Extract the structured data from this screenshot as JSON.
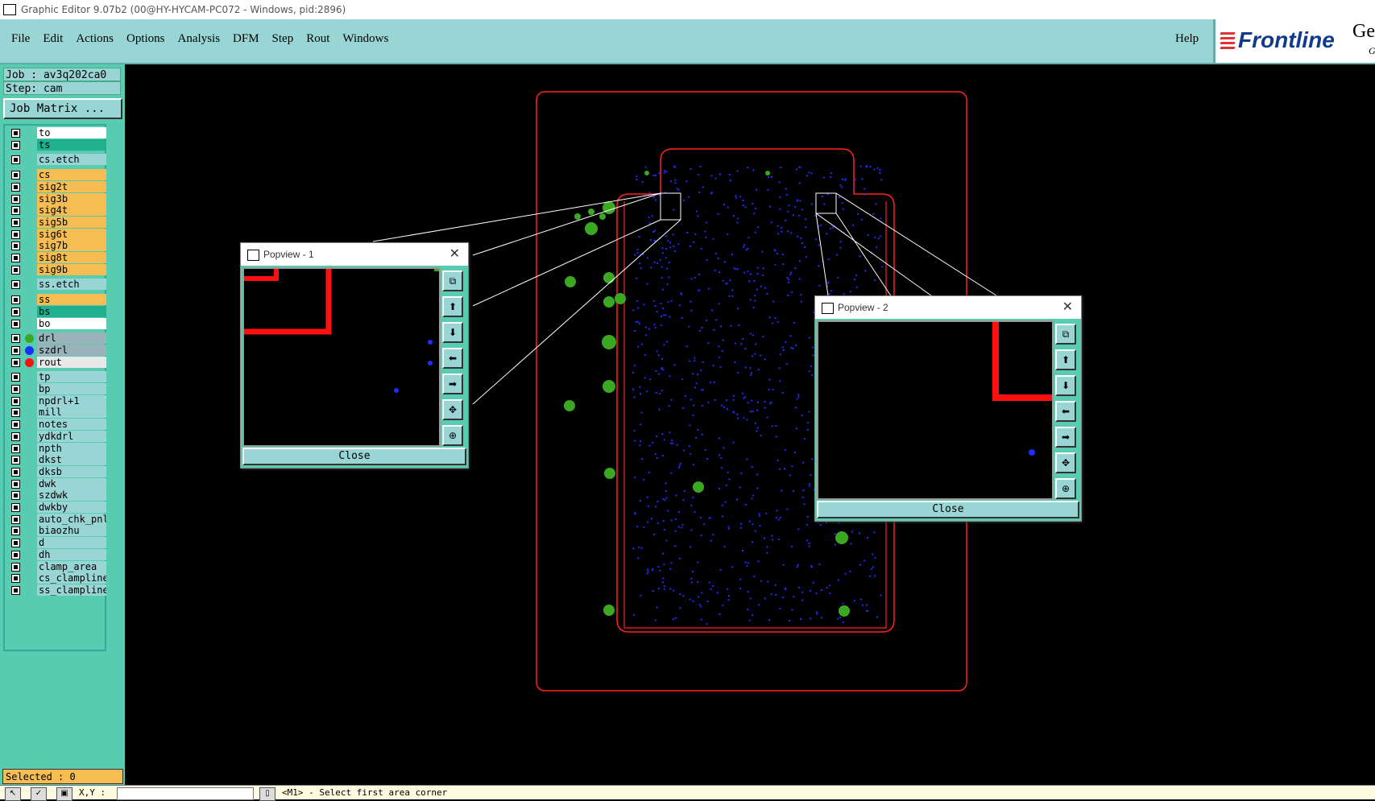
{
  "window": {
    "title": "Graphic Editor 9.07b2 (00@HY-HYCAM-PC072 - Windows, pid:2896)"
  },
  "menu": {
    "items": [
      "File",
      "Edit",
      "Actions",
      "Options",
      "Analysis",
      "DFM",
      "Step",
      "Rout",
      "Windows"
    ],
    "help": "Help"
  },
  "brand": {
    "logo_text": "Frontline",
    "extra": "Ge",
    "extra2": "G"
  },
  "job": {
    "job_label": "Job : av3q202ca0",
    "step_label": "Step: cam",
    "matrix_button": "Job Matrix ..."
  },
  "layers": [
    {
      "name": "to",
      "color": "#ffffff",
      "dot": ""
    },
    {
      "name": "ts",
      "color": "#1fb08e",
      "dot": ""
    },
    {
      "name": "cs.etch",
      "color": "#99d5d5",
      "dot": ""
    },
    {
      "name": "cs",
      "color": "#f5bd52",
      "dot": ""
    },
    {
      "name": "sig2t",
      "color": "#f5bd52",
      "dot": ""
    },
    {
      "name": "sig3b",
      "color": "#f5bd52",
      "dot": ""
    },
    {
      "name": "sig4t",
      "color": "#f5bd52",
      "dot": ""
    },
    {
      "name": "sig5b",
      "color": "#f5bd52",
      "dot": ""
    },
    {
      "name": "sig6t",
      "color": "#f5bd52",
      "dot": ""
    },
    {
      "name": "sig7b",
      "color": "#f5bd52",
      "dot": ""
    },
    {
      "name": "sig8t",
      "color": "#f5bd52",
      "dot": ""
    },
    {
      "name": "sig9b",
      "color": "#f5bd52",
      "dot": ""
    },
    {
      "name": "ss.etch",
      "color": "#99d5d5",
      "dot": ""
    },
    {
      "name": "ss",
      "color": "#f5bd52",
      "dot": ""
    },
    {
      "name": "bs",
      "color": "#1fb08e",
      "dot": ""
    },
    {
      "name": "bo",
      "color": "#ffffff",
      "dot": ""
    },
    {
      "name": "drl",
      "color": "#9ab3bb",
      "dot": "#3aa820"
    },
    {
      "name": "szdrl",
      "color": "#9ab3bb",
      "dot": "#1530ff"
    },
    {
      "name": "rout",
      "color": "#e8e8e8",
      "dot": "#ff1010"
    },
    {
      "name": "tp",
      "color": "#99d5d5",
      "dot": ""
    },
    {
      "name": "bp",
      "color": "#99d5d5",
      "dot": ""
    },
    {
      "name": "npdrl+1",
      "color": "#99d5d5",
      "dot": ""
    },
    {
      "name": "mill",
      "color": "#99d5d5",
      "dot": ""
    },
    {
      "name": "notes",
      "color": "#99d5d5",
      "dot": ""
    },
    {
      "name": "ydkdrl",
      "color": "#99d5d5",
      "dot": ""
    },
    {
      "name": "npth",
      "color": "#99d5d5",
      "dot": ""
    },
    {
      "name": "dkst",
      "color": "#99d5d5",
      "dot": ""
    },
    {
      "name": "dksb",
      "color": "#99d5d5",
      "dot": ""
    },
    {
      "name": "dwk",
      "color": "#99d5d5",
      "dot": ""
    },
    {
      "name": "szdwk",
      "color": "#99d5d5",
      "dot": ""
    },
    {
      "name": "dwkby",
      "color": "#99d5d5",
      "dot": ""
    },
    {
      "name": "auto_chk_pnl",
      "color": "#99d5d5",
      "dot": ""
    },
    {
      "name": "biaozhu",
      "color": "#99d5d5",
      "dot": ""
    },
    {
      "name": "d",
      "color": "#99d5d5",
      "dot": ""
    },
    {
      "name": "dh",
      "color": "#99d5d5",
      "dot": ""
    },
    {
      "name": "clamp_area",
      "color": "#99d5d5",
      "dot": ""
    },
    {
      "name": "cs_clampline",
      "color": "#99d5d5",
      "dot": ""
    },
    {
      "name": "ss_clampline",
      "color": "#99d5d5",
      "dot": ""
    }
  ],
  "selected": {
    "label": "Selected : 0"
  },
  "status": {
    "xy_label": "X,Y :",
    "message": "<M1> - Select first area corner"
  },
  "popview1": {
    "title": "Popview - 1",
    "close_label": "Close"
  },
  "popview2": {
    "title": "Popview - 2",
    "close_label": "Close"
  },
  "colors": {
    "profile": "#ff2020",
    "pads": "#3aa820",
    "vias": "#1f2dff",
    "panel_bg": "#57ccb0",
    "button_bg": "#99d5d5"
  }
}
